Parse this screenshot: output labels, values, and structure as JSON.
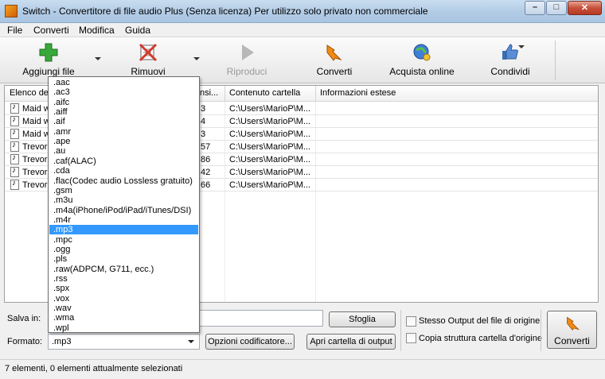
{
  "window": {
    "title": "Switch - Convertitore di file audio Plus (Senza licenza) Per utilizzo solo privato non commerciale",
    "minimize": "–",
    "maximize": "□",
    "close": "✕"
  },
  "menu": [
    "File",
    "Converti",
    "Modifica",
    "Guida"
  ],
  "toolbar": {
    "add": "Aggiungi file",
    "remove": "Rimuovi",
    "play": "Riproduci",
    "convert": "Converti",
    "buy": "Acquista online",
    "share": "Condividi"
  },
  "list": {
    "headers": [
      "Elenco dei",
      "nsi...",
      "Contenuto cartella",
      "Informazioni estese"
    ],
    "rows": [
      {
        "name": "Maid wi",
        "size": "3",
        "folder": "C:\\Users\\MarioP\\M..."
      },
      {
        "name": "Maid wi",
        "size": "4",
        "folder": "C:\\Users\\MarioP\\M..."
      },
      {
        "name": "Maid wi",
        "size": "3",
        "folder": "C:\\Users\\MarioP\\M..."
      },
      {
        "name": "Trevor I",
        "size": "57",
        "folder": "C:\\Users\\MarioP\\M..."
      },
      {
        "name": "Trevor I",
        "size": "86",
        "folder": "C:\\Users\\MarioP\\M..."
      },
      {
        "name": "Trevor I",
        "size": "42",
        "folder": "C:\\Users\\MarioP\\M..."
      },
      {
        "name": "Trevor I",
        "size": "66",
        "folder": "C:\\Users\\MarioP\\M..."
      }
    ]
  },
  "format_options": [
    ".aac",
    ".ac3",
    ".aifc",
    ".aiff",
    ".aif",
    ".amr",
    ".ape",
    ".au",
    ".caf(ALAC)",
    ".cda",
    ".flac(Codec audio Lossless gratuito)",
    ".gsm",
    ".m3u",
    ".m4a(iPhone/iPod/iPad/iTunes/DSI)",
    ".m4r",
    ".mp3",
    ".mpc",
    ".ogg",
    ".pls",
    ".raw(ADPCM, G711, ecc.)",
    ".rss",
    ".spx",
    ".vox",
    ".wav",
    ".wma",
    ".wpl"
  ],
  "selected_format_index": 15,
  "bottom": {
    "save_label": "Salva in:",
    "save_value": "",
    "browse": "Sfoglia",
    "format_label": "Formato:",
    "format_value": ".mp3",
    "encoder_options": "Opzioni codificatore...",
    "open_output": "Apri cartella di output",
    "same_output": "Stesso Output del file di origine",
    "copy_structure": "Copia struttura cartella d'origine",
    "convert": "Converti"
  },
  "status": "7 elementi, 0 elementi attualmente selezionati",
  "colors": {
    "selection": "#3399ff",
    "add_icon": "#3aa83a",
    "convert_icon": "#f08a12"
  }
}
